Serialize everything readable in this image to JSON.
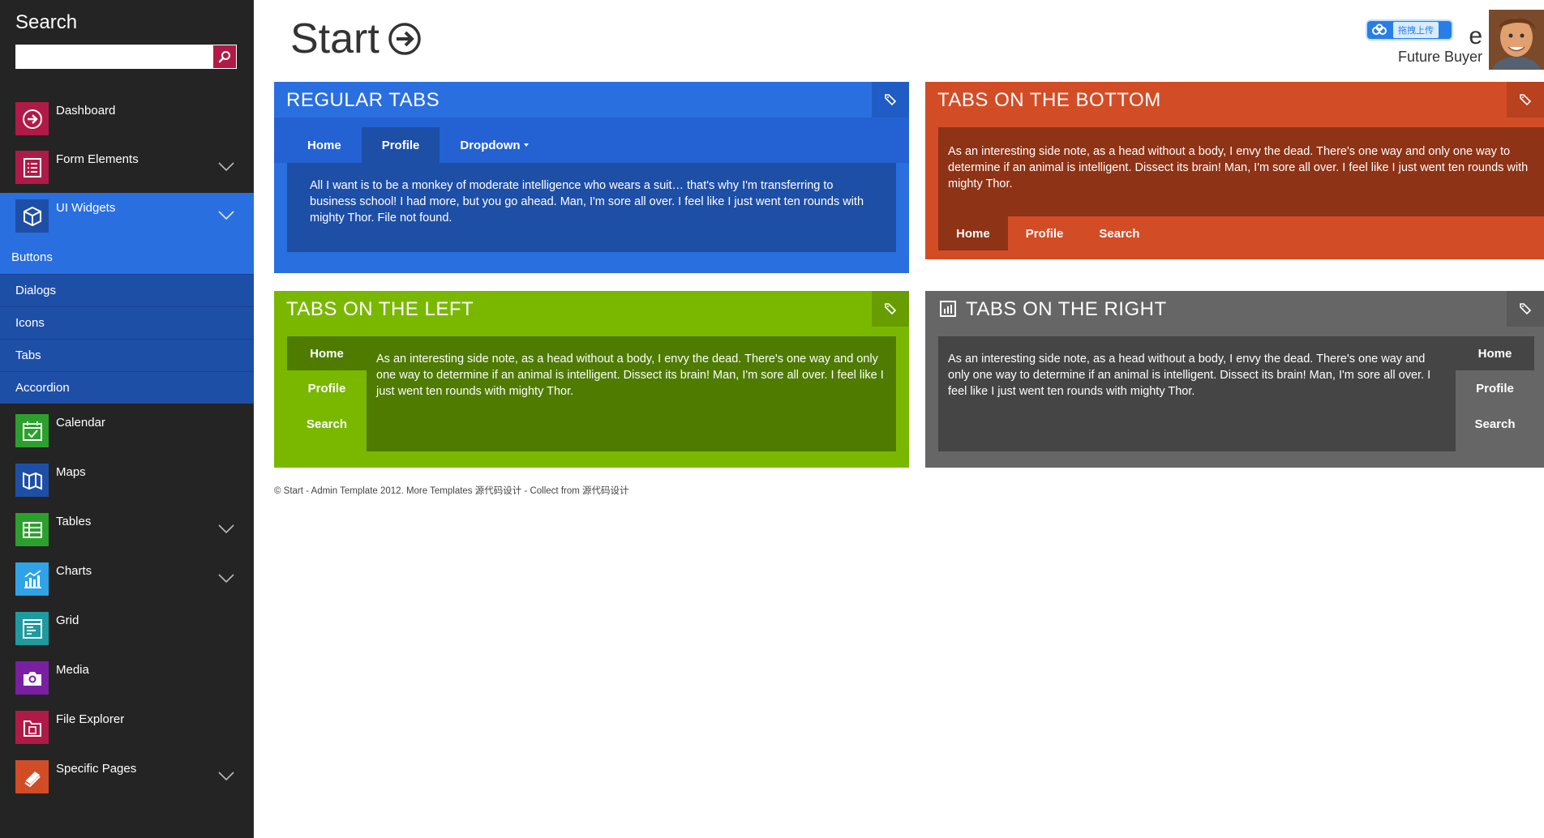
{
  "sidebar": {
    "search_title": "Search",
    "search_placeholder": "",
    "items": [
      {
        "label": "Dashboard",
        "color": "#b01a46",
        "icon": "arrow-circle-icon",
        "top": 0
      },
      {
        "label": "Form Elements",
        "color": "#b01a46",
        "icon": "list-icon"
      },
      {
        "label": "UI Widgets",
        "color": "#1e4fa7",
        "icon": "cube-icon"
      },
      {
        "label": "Calendar",
        "color": "#2ca02c",
        "icon": "calendar-icon"
      },
      {
        "label": "Maps",
        "color": "#1e4fa7",
        "icon": "map-icon"
      },
      {
        "label": "Tables",
        "color": "#2ca02c",
        "icon": "table-icon"
      },
      {
        "label": "Charts",
        "color": "#2fa3e6",
        "icon": "bar-chart-icon"
      },
      {
        "label": "Grid",
        "color": "#1e9aa0",
        "icon": "grid-icon"
      },
      {
        "label": "Media",
        "color": "#7a1fa2",
        "icon": "camera-icon"
      },
      {
        "label": "File Explorer",
        "color": "#b01a46",
        "icon": "folder-icon"
      },
      {
        "label": "Specific Pages",
        "color": "#d24d26",
        "icon": "book-icon"
      }
    ],
    "subitems": [
      "Buttons",
      "Dialogs",
      "Icons",
      "Tabs",
      "Accordion"
    ]
  },
  "header": {
    "title": "Start",
    "user_name": "Future Buyer",
    "upload_text": "拖拽上传"
  },
  "panels": {
    "regular": {
      "title": "REGULAR TABS",
      "tabs": [
        "Home",
        "Profile",
        "Dropdown"
      ],
      "text": "All I want is to be a monkey of moderate intelligence who wears a suit… that's why I'm transferring to business school! I had more, but you go ahead. Man, I'm sore all over. I feel like I just went ten rounds with mighty Thor. File not found."
    },
    "bottom": {
      "title": "TABS ON THE BOTTOM",
      "tabs": [
        "Home",
        "Profile",
        "Search"
      ],
      "text": "As an interesting side note, as a head without a body, I envy the dead. There's one way and only one way to determine if an animal is intelligent. Dissect its brain! Man, I'm sore all over. I feel like I just went ten rounds with mighty Thor."
    },
    "left": {
      "title": "TABS ON THE LEFT",
      "tabs": [
        "Home",
        "Profile",
        "Search"
      ],
      "text": "As an interesting side note, as a head without a body, I envy the dead. There's one way and only one way to determine if an animal is intelligent. Dissect its brain! Man, I'm sore all over. I feel like I just went ten rounds with mighty Thor."
    },
    "right": {
      "title": "TABS ON THE RIGHT",
      "tabs": [
        "Home",
        "Profile",
        "Search"
      ],
      "text": "As an interesting side note, as a head without a body, I envy the dead. There's one way and only one way to determine if an animal is intelligent. Dissect its brain! Man, I'm sore all over. I feel like I just went ten rounds with mighty Thor."
    }
  },
  "footer": "© Start - Admin Template 2012. More Templates 源代码设计 - Collect from 源代码设计"
}
